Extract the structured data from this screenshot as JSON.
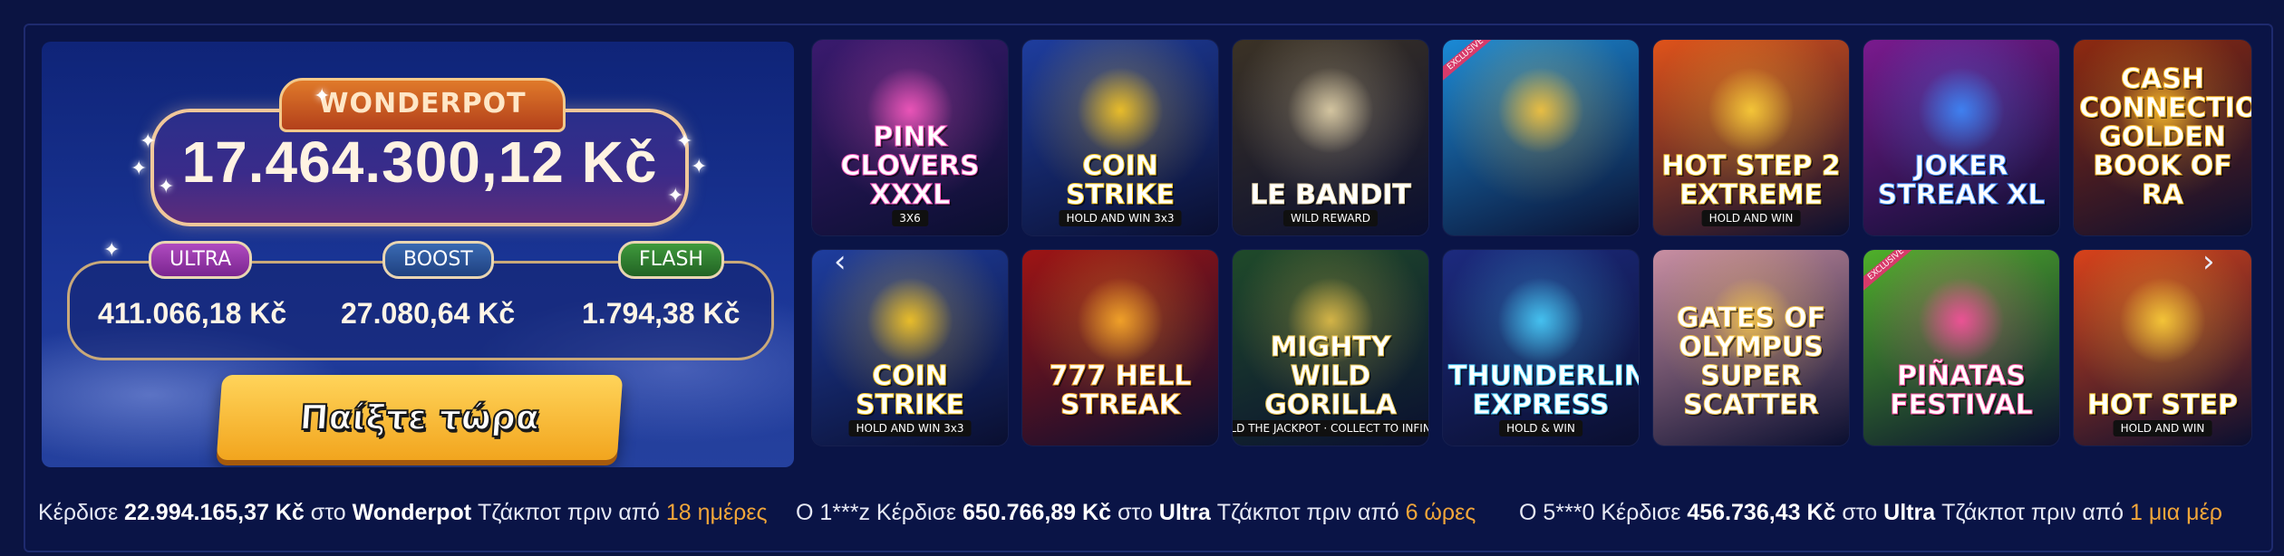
{
  "jackpot": {
    "brand": "WONDERPOT",
    "main_amount": "17.464.300,12 Kč",
    "tiers": [
      {
        "label": "ULTRA",
        "amount": "411.066,18 Kč"
      },
      {
        "label": "BOOST",
        "amount": "27.080,64 Kč"
      },
      {
        "label": "FLASH",
        "amount": "1.794,38 Kč"
      }
    ],
    "play_button": "Παίξτε τώρα"
  },
  "games": [
    {
      "title": "PINK CLOVERS XXXL",
      "tag": "3X6",
      "bg": "#3a1a6e",
      "accent": "#ff5bc2"
    },
    {
      "title": "COIN STRIKE",
      "tag": "HOLD AND WIN 3x3",
      "bg": "#1e3d9e",
      "accent": "#ffcc22"
    },
    {
      "title": "LE BANDIT",
      "tag": "WILD REWARD",
      "bg": "#3b3225",
      "accent": "#e6d6ad"
    },
    {
      "title": "",
      "tag": "",
      "bg": "#1b8ad6",
      "accent": "#ffc83a",
      "exclusive": "EXCLUSIVE"
    },
    {
      "title": "HOT STEP 2 EXTREME",
      "tag": "HOLD AND WIN",
      "bg": "#e0531a",
      "accent": "#ffd43a"
    },
    {
      "title": "JOKER STREAK XL",
      "tag": "",
      "bg": "#7a1a8e",
      "accent": "#3d8cff"
    },
    {
      "title": "CASH CONNECTION GOLDEN BOOK OF RA",
      "tag": "",
      "bg": "#8e2a10",
      "accent": "#ffc02a"
    },
    {
      "title": "COIN STRIKE",
      "tag": "HOLD AND WIN 3x3",
      "bg": "#1e3d9e",
      "accent": "#ffcc22"
    },
    {
      "title": "777 HELL STREAK",
      "tag": "",
      "bg": "#9e1414",
      "accent": "#ffb02a"
    },
    {
      "title": "MIGHTY WILD GORILLA",
      "tag": "HOLD THE JACKPOT · COLLECT TO INFINITY",
      "bg": "#1f4a2a",
      "accent": "#e8c24a"
    },
    {
      "title": "THUNDERLINE EXPRESS",
      "tag": "HOLD & WIN",
      "bg": "#1c2a7e",
      "accent": "#4ad2ff"
    },
    {
      "title": "GATES OF OLYMPUS SUPER SCATTER",
      "tag": "",
      "bg": "#c98fa2",
      "accent": "#f6c64a"
    },
    {
      "title": "PIÑATAS FESTIVAL",
      "tag": "",
      "bg": "#4fb02a",
      "accent": "#ff4fa0",
      "exclusive": "EXCLUSIVE"
    },
    {
      "title": "HOT STEP",
      "tag": "HOLD AND WIN",
      "bg": "#d8421a",
      "accent": "#ffd43a"
    }
  ],
  "ticker": [
    {
      "prefix": "Κέρδισε",
      "amount": "22.994.165,37 Kč",
      "mid": "στο",
      "pot": "Wonderpot",
      "tail": "Τζάκποτ πριν από",
      "time": "18 ημέρες"
    },
    {
      "prefix": "Ο 1***z Κέρδισε",
      "amount": "650.766,89 Kč",
      "mid": "στο",
      "pot": "Ultra",
      "tail": "Τζάκποτ πριν από",
      "time": "6 ώρες"
    },
    {
      "prefix": "Ο 5***0 Κέρδισε",
      "amount": "456.736,43 Kč",
      "mid": "στο",
      "pot": "Ultra",
      "tail": "Τζάκποτ πριν από",
      "time": "1 μια μέρ"
    }
  ]
}
